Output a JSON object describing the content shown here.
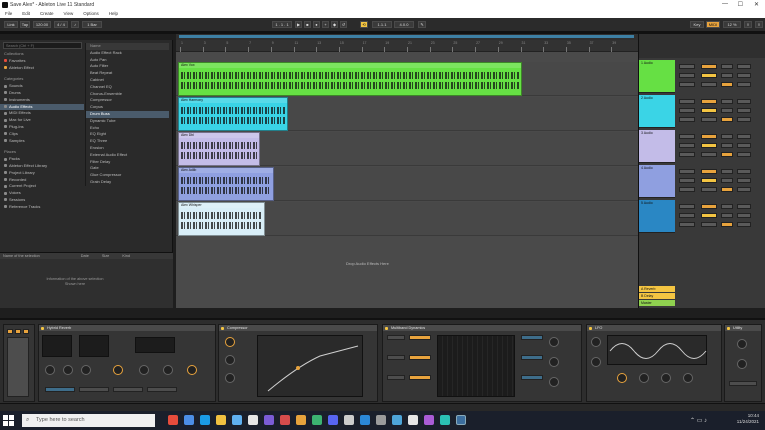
{
  "window": {
    "title": "Save Alex* - Ableton Live 11 Standard",
    "min": "—",
    "max": "☐",
    "close": "✕"
  },
  "menu": [
    "File",
    "Edit",
    "Create",
    "View",
    "Options",
    "Help"
  ],
  "browser": {
    "search_placeholder": "Search (Ctrl + F)",
    "collections_header": "Collections",
    "collections": [
      "Favorites",
      "Ableton Effect"
    ],
    "categories_header": "Categories",
    "categories": [
      "Sounds",
      "Drums",
      "Instruments",
      "Audio Effects",
      "MIDI Effects",
      "Max for Live",
      "Plug-Ins",
      "Clips",
      "Samples"
    ],
    "places_header": "Places",
    "places": [
      "Packs",
      "Ableton Effect Library",
      "Project Library",
      "Recorded",
      "Current Project",
      "Voices",
      "Sessions",
      "Reference Tracks"
    ],
    "items": [
      "Audio Effect Rack",
      "Auto Pan",
      "Auto Filter",
      "Beat Repeat",
      "Cabinet",
      "Channel EQ",
      "Chorus-Ensemble",
      "Compressor",
      "Corpus",
      "Drum Buss",
      "Dynamic Tube",
      "Echo",
      "EQ Eight",
      "EQ Three",
      "Erosion",
      "External Audio Effect",
      "Filter Delay",
      "Gate",
      "Glue Compressor",
      "Grain Delay"
    ],
    "info_header": [
      "Name of the selection",
      "Date",
      "Size",
      "Kind"
    ],
    "info_message_1": "Information of the above selection",
    "info_message_2": "Shown here"
  },
  "transport": {
    "link": "Link",
    "tap": "Tap",
    "tempo": "120.00",
    "sig": "4 / 4",
    "bar": "1 . 1 . 1",
    "key": "Key",
    "midi": "MIDI",
    "cpu": "12 %"
  },
  "arrangement": {
    "drop_message": "Drop Audio Effects Here",
    "ruler": [
      "1",
      "3",
      "5",
      "7",
      "9",
      "11",
      "13",
      "15",
      "17",
      "19",
      "21",
      "23",
      "25",
      "27",
      "29",
      "31",
      "33",
      "35",
      "37",
      "39"
    ]
  },
  "tracks": [
    {
      "name": "1 Audio",
      "clip": "Alex Vox",
      "color": "#66e044",
      "len": 0.75
    },
    {
      "name": "2 Audio",
      "clip": "Alex Harmony",
      "color": "#3ad4e6",
      "len": 0.24
    },
    {
      "name": "3 Audio",
      "clip": "Alex Dbl",
      "color": "#c3bce8",
      "len": 0.18
    },
    {
      "name": "4 Audio",
      "clip": "Alex Adlib",
      "color": "#8f9fe0",
      "len": 0.21
    },
    {
      "name": "5 Audio",
      "clip": "Alex Whisper",
      "color": "#d8eef7",
      "len": 0.19
    }
  ],
  "mixer": {
    "tracks": [
      {
        "name": "1 Audio",
        "color": "#66e044"
      },
      {
        "name": "2 Audio",
        "color": "#3ad4e6"
      },
      {
        "name": "3 Audio",
        "color": "#c3bce8"
      },
      {
        "name": "4 Audio",
        "color": "#8f9fe0"
      },
      {
        "name": "5 Audio",
        "color": "#2a87c4"
      }
    ],
    "returns": [
      "A Reverb",
      "B Delay"
    ],
    "master": "Master"
  },
  "devices": [
    {
      "name": "Hybrid Reverb",
      "width": 0.3
    },
    {
      "name": "Compressor",
      "width": 0.18
    },
    {
      "name": "Multiband Dynamics",
      "width": 0.27
    },
    {
      "name": "LFO",
      "width": 0.18
    },
    {
      "name": "Utility",
      "width": 0.05
    }
  ],
  "taskbar": {
    "search_placeholder": "Type here to search",
    "time": "10:44",
    "date": "11/24/2021"
  },
  "colors": {
    "accent": "#e8a33d",
    "yellow": "#f4c542",
    "selection": "#4a5b6b"
  }
}
